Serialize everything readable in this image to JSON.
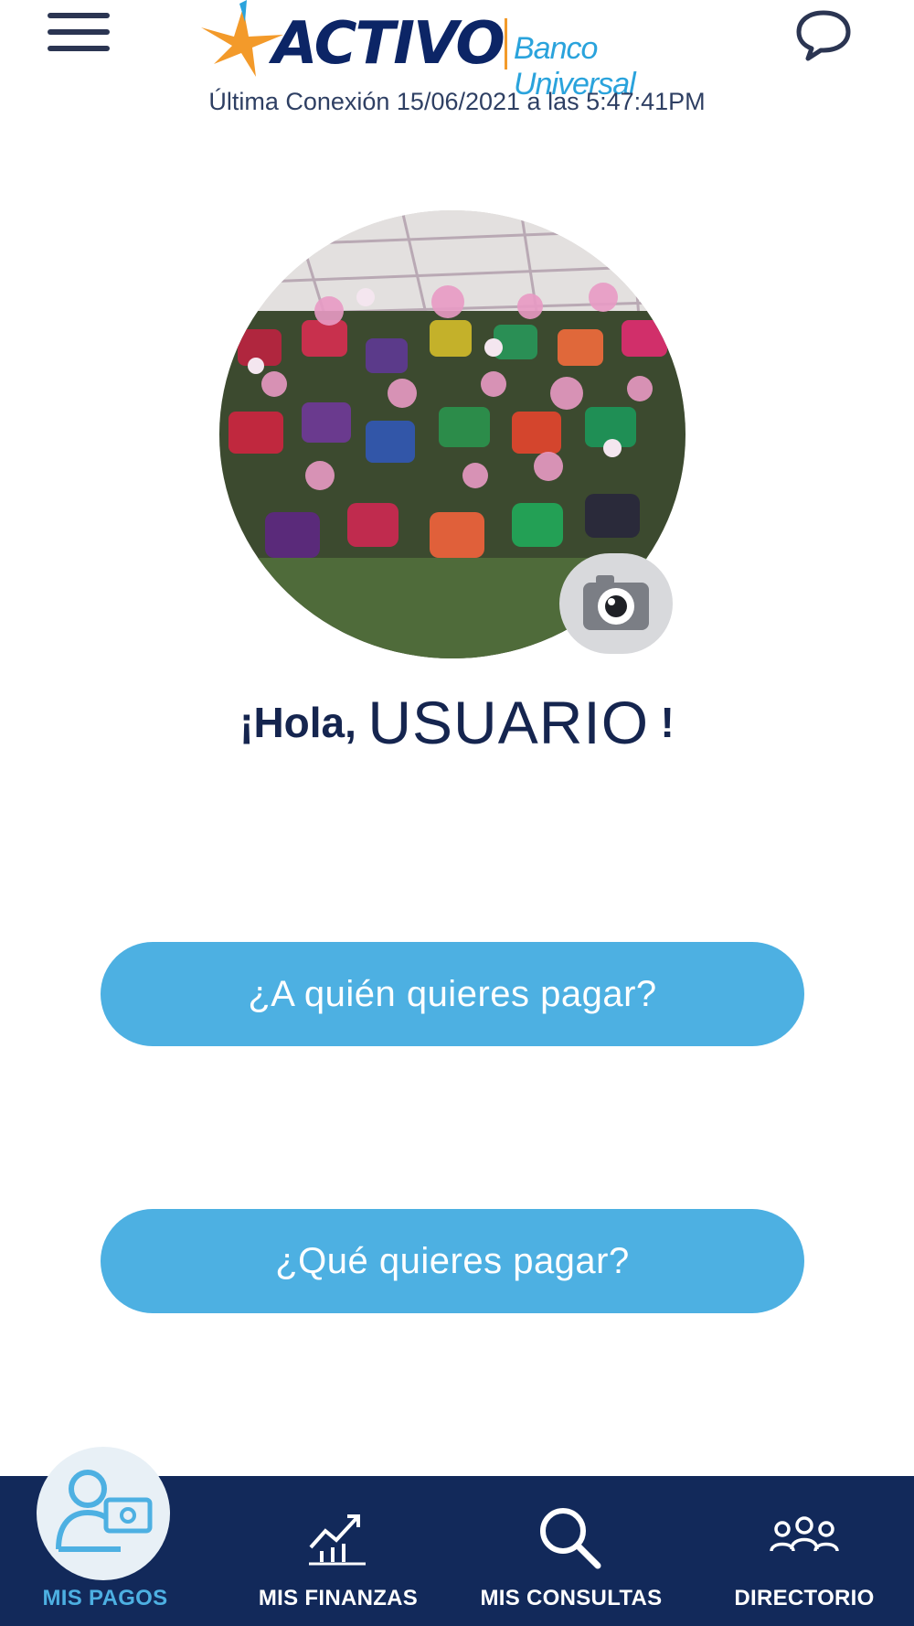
{
  "header": {
    "brand_name": "ACTIVO",
    "brand_subtitle": "Banco Universal",
    "last_connection": "Última  Conexión 15/06/2021 a las 5:47:41PM"
  },
  "greeting": {
    "prefix": "¡Hola,",
    "user": "USUARIO",
    "suffix": "!"
  },
  "actions": {
    "who_to_pay": "¿A quién quieres pagar?",
    "what_to_pay": "¿Qué quieres pagar?"
  },
  "nav": {
    "items": [
      {
        "label": "MIS PAGOS",
        "active": true
      },
      {
        "label": "MIS FINANZAS"
      },
      {
        "label": "MIS CONSULTAS"
      },
      {
        "label": "DIRECTORIO"
      }
    ]
  },
  "colors": {
    "primary": "#12295a",
    "accent": "#4db0e2",
    "logo_orange": "#f39a2a"
  },
  "icons": [
    "hamburger-menu-icon",
    "chat-bubble-icon",
    "camera-icon",
    "payment-user-icon",
    "chart-growth-icon",
    "search-icon",
    "people-group-icon"
  ]
}
